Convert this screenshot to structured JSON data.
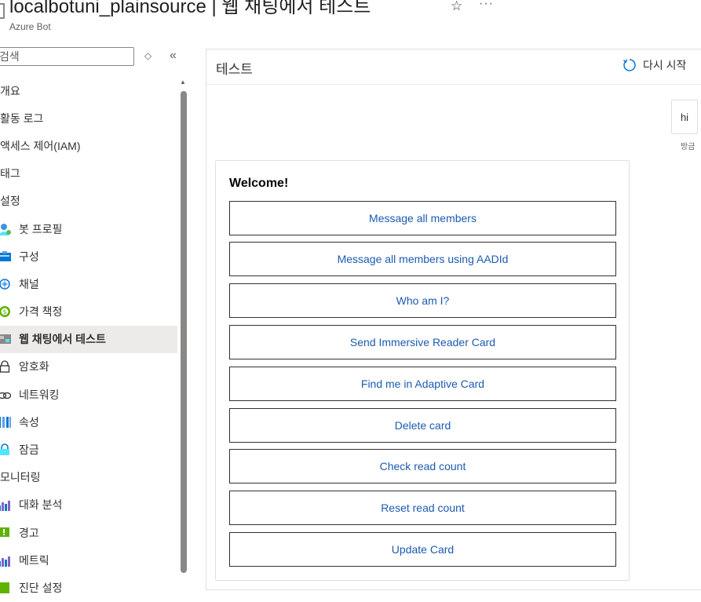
{
  "header": {
    "title": "localbotuni_plainsource | 웹 채팅에서 테스트",
    "subtitle": "Azure Bot",
    "favorite_icon": "star-icon",
    "more_label": "···"
  },
  "sidebar": {
    "search_placeholder": "검색",
    "items": [
      {
        "label": "개요",
        "kind": "top"
      },
      {
        "label": "활동 로그",
        "kind": "top"
      },
      {
        "label": "액세스 제어(IAM)",
        "kind": "top"
      },
      {
        "label": "태그",
        "kind": "top"
      },
      {
        "label": "설정",
        "kind": "section"
      },
      {
        "label": "봇 프로필",
        "kind": "sub",
        "icon": "bot-profile-icon"
      },
      {
        "label": "구성",
        "kind": "sub",
        "icon": "configuration-icon"
      },
      {
        "label": "채널",
        "kind": "sub",
        "icon": "channels-icon"
      },
      {
        "label": "가격 책정",
        "kind": "sub",
        "icon": "pricing-icon"
      },
      {
        "label": "웹 채팅에서 테스트",
        "kind": "sub",
        "icon": "webchat-icon",
        "active": true
      },
      {
        "label": "암호화",
        "kind": "sub",
        "icon": "lock-icon"
      },
      {
        "label": "네트워킹",
        "kind": "sub",
        "icon": "networking-icon"
      },
      {
        "label": "속성",
        "kind": "sub",
        "icon": "properties-icon"
      },
      {
        "label": "잠금",
        "kind": "sub",
        "icon": "locks-icon"
      },
      {
        "label": "모니터링",
        "kind": "section"
      },
      {
        "label": "대화 분석",
        "kind": "sub",
        "icon": "analytics-icon"
      },
      {
        "label": "경고",
        "kind": "sub",
        "icon": "alert-icon"
      },
      {
        "label": "메트릭",
        "kind": "sub",
        "icon": "metrics-icon"
      },
      {
        "label": "진단 설정",
        "kind": "sub",
        "icon": "diagnostics-icon"
      }
    ]
  },
  "panel": {
    "title": "테스트",
    "restart_label": "다시 시작"
  },
  "chat": {
    "user_message": "hi",
    "user_status": "방금",
    "card": {
      "title": "Welcome!",
      "buttons": [
        "Message all members",
        "Message all members using AADId",
        "Who am I?",
        "Send Immersive Reader Card",
        "Find me in Adaptive Card",
        "Delete card",
        "Check read count",
        "Reset read count",
        "Update Card"
      ]
    }
  },
  "colors": {
    "link_blue": "#1b5baf",
    "active_bg": "#edebe9",
    "border": "#e1dfdd",
    "restart_icon": "#0078d4"
  }
}
